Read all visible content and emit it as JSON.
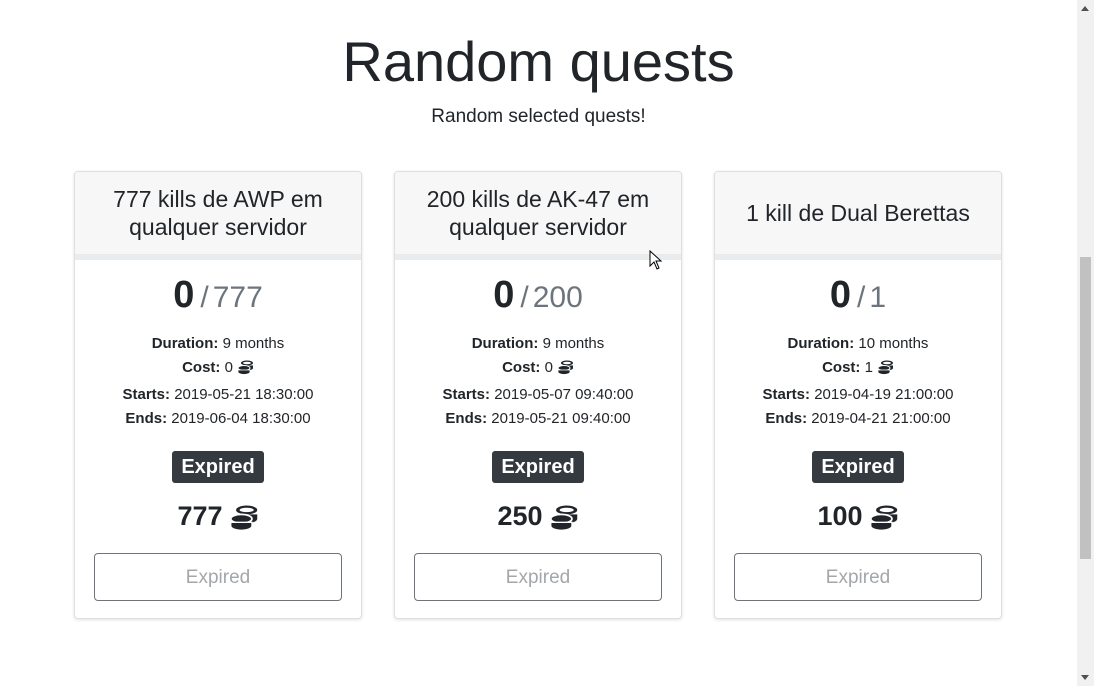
{
  "page": {
    "title": "Random quests",
    "subtitle": "Random selected quests!"
  },
  "labels": {
    "duration": "Duration:",
    "cost": "Cost:",
    "starts": "Starts:",
    "ends": "Ends:",
    "slash": "/"
  },
  "quests": [
    {
      "title": "777 kills de AWP em qualquer servidor",
      "progress": "0",
      "goal": "777",
      "duration": "9 months",
      "cost": "0",
      "starts": "2019-05-21 18:30:00",
      "ends": "2019-06-04 18:30:00",
      "status": "Expired",
      "reward": "777",
      "button": "Expired"
    },
    {
      "title": "200 kills de AK-47 em qualquer servidor",
      "progress": "0",
      "goal": "200",
      "duration": "9 months",
      "cost": "0",
      "starts": "2019-05-07 09:40:00",
      "ends": "2019-05-21 09:40:00",
      "status": "Expired",
      "reward": "250",
      "button": "Expired"
    },
    {
      "title": "1 kill de Dual Berettas",
      "progress": "0",
      "goal": "1",
      "duration": "10 months",
      "cost": "1",
      "starts": "2019-04-19 21:00:00",
      "ends": "2019-04-21 21:00:00",
      "status": "Expired",
      "reward": "100",
      "button": "Expired"
    }
  ],
  "icons": {
    "coin": "coins-icon"
  },
  "colors": {
    "badge": "#343a40",
    "muted": "#6c757d"
  }
}
